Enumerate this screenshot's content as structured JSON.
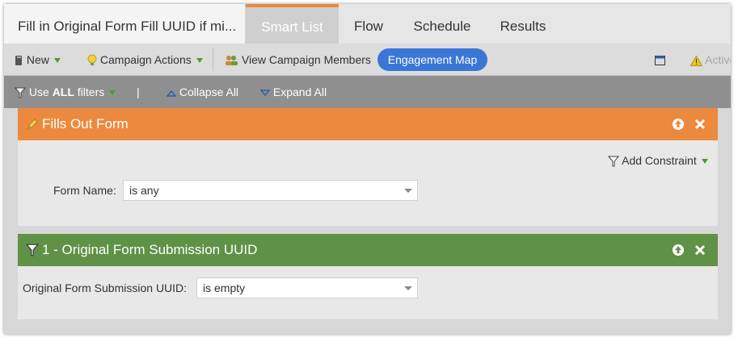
{
  "tabs": {
    "title": "Fill in Original Form Fill UUID if mi...",
    "items": [
      "Smart List",
      "Flow",
      "Schedule",
      "Results"
    ]
  },
  "toolbar": {
    "new_label": "New",
    "campaign_actions_label": "Campaign Actions",
    "view_members_label": "View Campaign Members",
    "engagement_map_label": "Engagement Map",
    "active_label": "Active"
  },
  "filterbar": {
    "use_prefix": "Use ",
    "use_bold": "ALL",
    "use_suffix": " filters",
    "separator": "|",
    "collapse_label": "Collapse All",
    "expand_label": "Expand All"
  },
  "filter1": {
    "title": "Fills Out Form",
    "add_constraint_label": "Add Constraint",
    "field_label": "Form Name:",
    "field_value": "is any"
  },
  "filter2": {
    "title": "1 - Original Form Submission UUID",
    "field_label": "Original Form Submission UUID:",
    "field_value": "is empty"
  },
  "colors": {
    "orange_header": "#eb8a3e",
    "green_header": "#5f9146",
    "accent_blue": "#3a76d6"
  }
}
